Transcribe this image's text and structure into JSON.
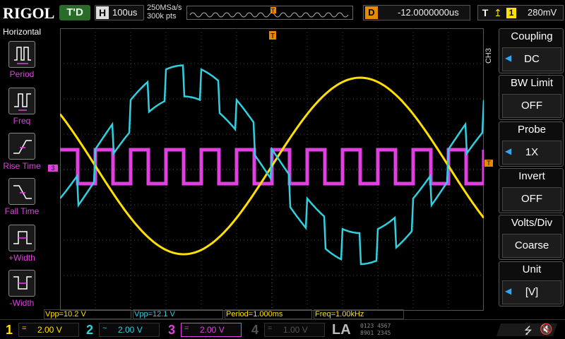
{
  "header": {
    "brand": "RIGOL",
    "run_status": "T'D",
    "timebase_label": "H",
    "timebase": "100us",
    "sample_rate": "250MSa/s",
    "memory_depth": "300k pts",
    "delay_label": "D",
    "delay": "-12.0000000us",
    "trigger_label": "T",
    "trigger_source": "1",
    "trigger_level": "280mV"
  },
  "left_panel": {
    "title": "Horizontal",
    "items": [
      {
        "label": "Period"
      },
      {
        "label": "Freq"
      },
      {
        "label": "Rise Time"
      },
      {
        "label": "Fall Time"
      },
      {
        "label": "+Width"
      },
      {
        "label": "-Width"
      }
    ]
  },
  "right_panel": {
    "channel": "CH3",
    "items": [
      {
        "title": "Coupling",
        "value": "DC"
      },
      {
        "title": "BW Limit",
        "value": "OFF"
      },
      {
        "title": "Probe",
        "value": "1X"
      },
      {
        "title": "Invert",
        "value": "OFF"
      },
      {
        "title": "Volts/Div",
        "value": "Coarse"
      },
      {
        "title": "Unit",
        "value": "[V]"
      }
    ]
  },
  "measurements": [
    {
      "text": "Vpp=10.2 V",
      "color": "#ffe000"
    },
    {
      "text": "Vpp=12.1 V",
      "color": "#2fd0e0"
    },
    {
      "text": "Period=1.000ms",
      "color": "#ffe000"
    },
    {
      "text": "Freq=1.00kHz",
      "color": "#ffe000"
    }
  ],
  "channels": [
    {
      "num": "1",
      "coupling": "=",
      "scale": "2.00 V",
      "color": "#ffe000"
    },
    {
      "num": "2",
      "coupling": "~",
      "scale": "2.00 V",
      "color": "#2fd0e0"
    },
    {
      "num": "3",
      "coupling": "=",
      "scale": "2.00 V",
      "color": "#e040e0"
    },
    {
      "num": "4",
      "coupling": "=",
      "scale": "1.00 V",
      "color": "#555555"
    }
  ],
  "la_label": "LA",
  "la_bits_row1": "0123 4567",
  "la_bits_row2": "8901 2345",
  "colors": {
    "ch1": "#ffe000",
    "ch2": "#2fd0e0",
    "ch3": "#e040e0",
    "trigger": "#e88a00"
  },
  "icons": [
    "usb-icon",
    "mute-icon",
    "trigger-edge-icon"
  ]
}
